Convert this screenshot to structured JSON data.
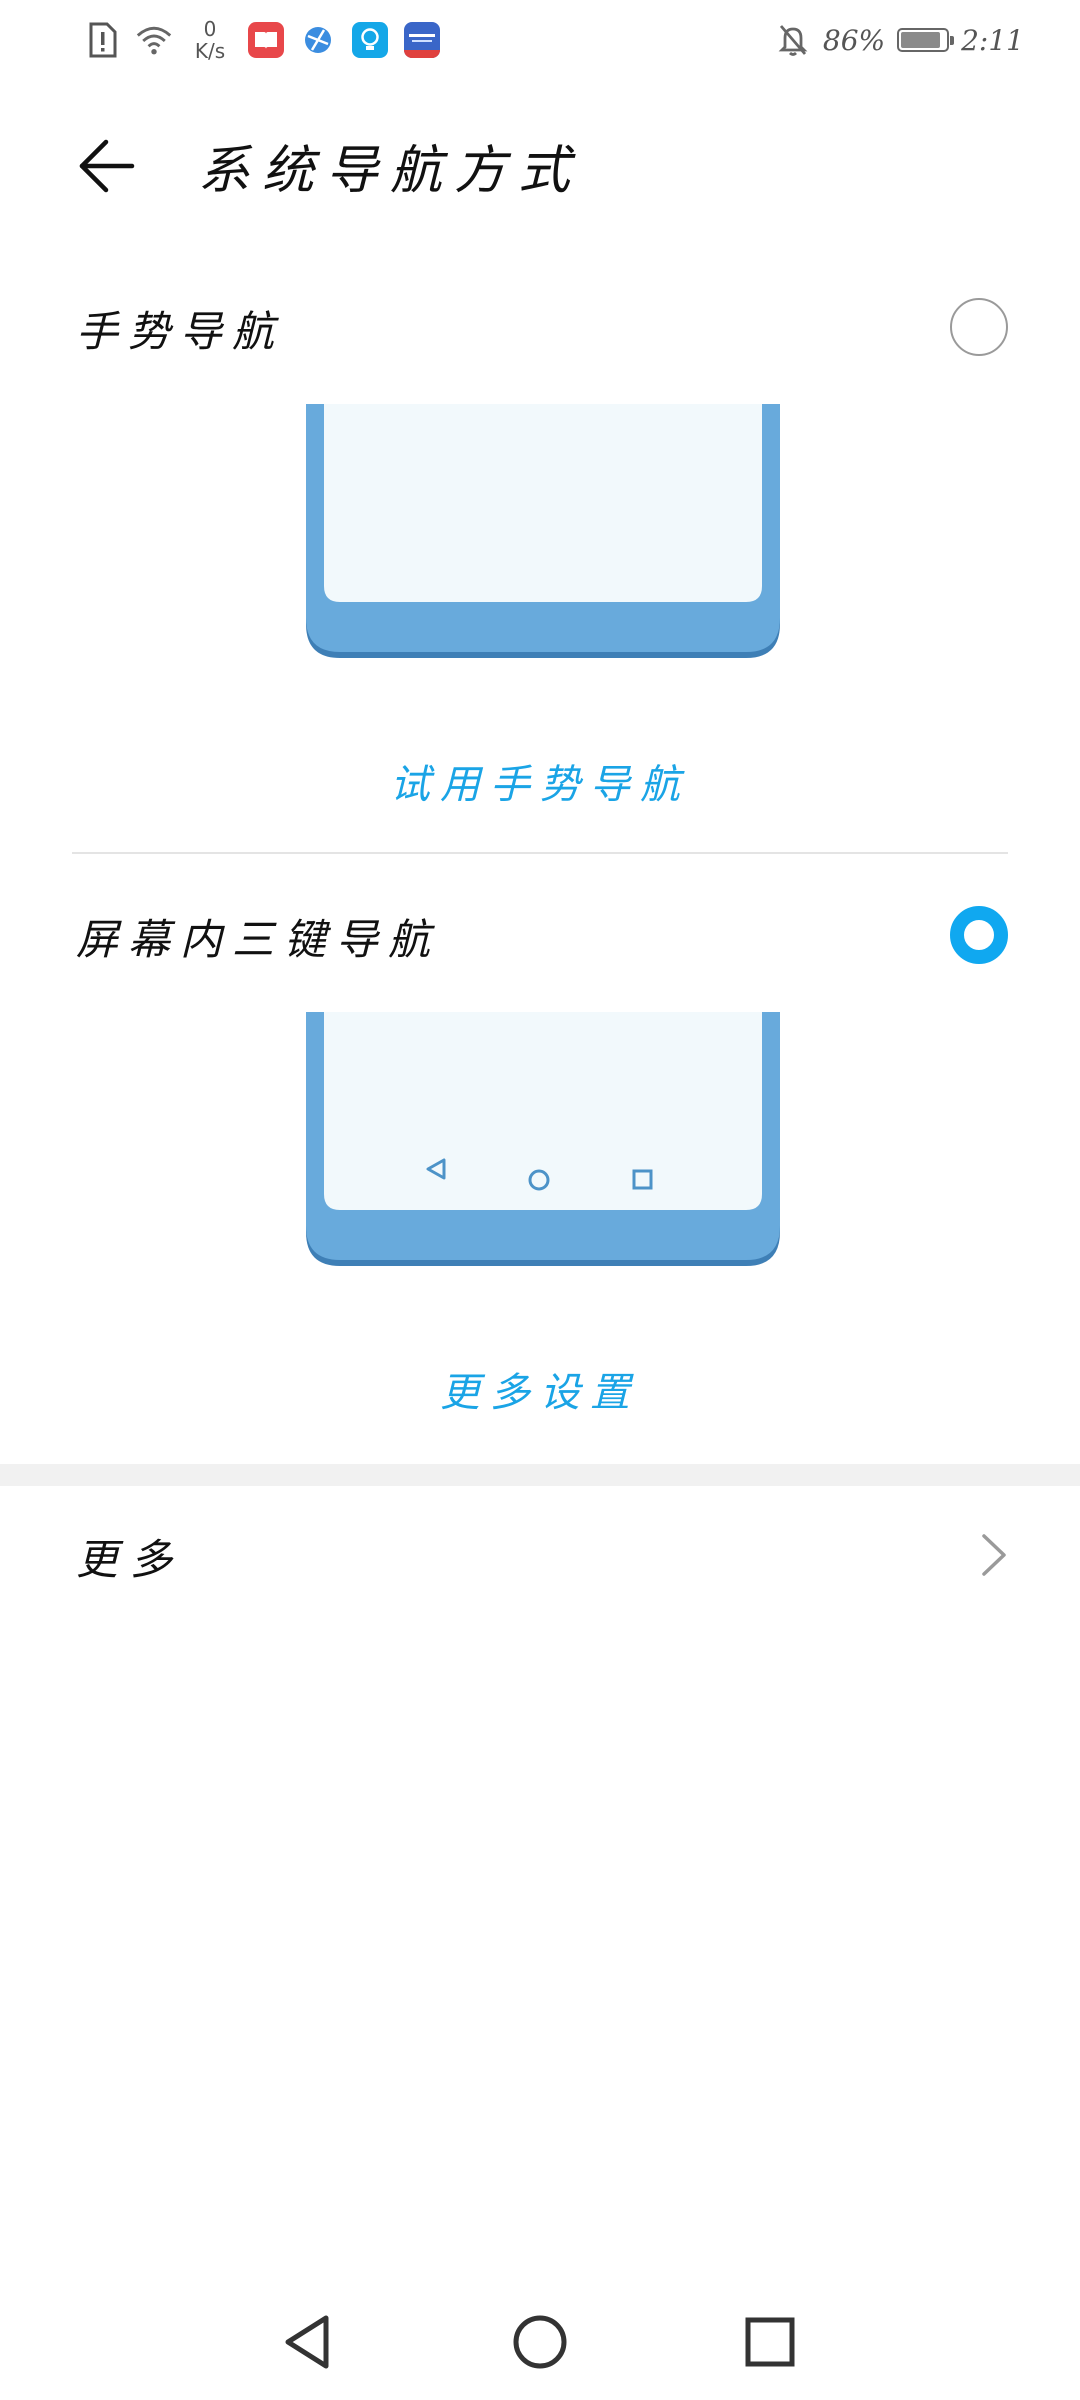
{
  "status_bar": {
    "netspeed_value": "0",
    "netspeed_unit": "K/s",
    "battery_percent": "86%",
    "time": "2:11",
    "icons": [
      "sim-alert-icon",
      "wifi-icon",
      "book-app-icon",
      "browser-app-icon",
      "lightbulb-app-icon",
      "ticket-app-icon",
      "bell-muted-icon",
      "battery-icon"
    ]
  },
  "header": {
    "title": "系统导航方式",
    "back_icon": "arrow-left-icon"
  },
  "options": [
    {
      "label": "手势导航",
      "selected": false,
      "link_label": "试用手势导航"
    },
    {
      "label": "屏幕内三键导航",
      "selected": true,
      "link_label": "更多设置"
    }
  ],
  "more": {
    "label": "更多",
    "icon": "chevron-right-icon"
  },
  "colors": {
    "accent": "#10a8f0",
    "link": "#1aa4e6",
    "phone_body": "#68aadc",
    "phone_screen": "#f2f9fc"
  },
  "nav_bar": {
    "icons": [
      "back-triangle-icon",
      "home-circle-icon",
      "recents-square-icon"
    ]
  }
}
